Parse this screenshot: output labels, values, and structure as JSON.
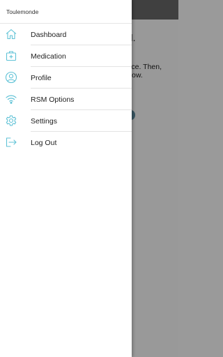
{
  "colors": {
    "icon": "#5fc2d6",
    "scrim": "rgba(0,0,0,0.40)",
    "drawer_bg": "#ffffff",
    "text": "#222222"
  },
  "background": {
    "heading_fragment": "ed.",
    "line1_fragment": "evice. Then,",
    "line2_fragment": "below."
  },
  "drawer": {
    "title": "Toulemonde",
    "items": [
      {
        "label": "Dashboard",
        "icon": "home-icon"
      },
      {
        "label": "Medication",
        "icon": "medical-kit-icon"
      },
      {
        "label": "Profile",
        "icon": "user-profile-icon"
      },
      {
        "label": "RSM Options",
        "icon": "wifi-icon"
      },
      {
        "label": "Settings",
        "icon": "gear-icon"
      },
      {
        "label": "Log Out",
        "icon": "logout-icon"
      }
    ]
  }
}
